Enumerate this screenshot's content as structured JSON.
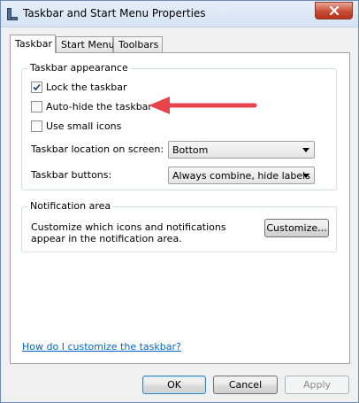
{
  "window": {
    "title": "Taskbar and Start Menu Properties",
    "close_glyph": "×"
  },
  "tabs": [
    {
      "label": "Taskbar",
      "active": true
    },
    {
      "label": "Start Menu",
      "active": false
    },
    {
      "label": "Toolbars",
      "active": false
    }
  ],
  "taskbar_appearance": {
    "label": "Taskbar appearance",
    "options": [
      {
        "label": "Lock the taskbar",
        "checked": true
      },
      {
        "label": "Auto-hide the taskbar",
        "checked": false
      },
      {
        "label": "Use small icons",
        "checked": false
      }
    ],
    "location": {
      "label": "Taskbar location on screen:",
      "value": "Bottom"
    },
    "buttons": {
      "label": "Taskbar buttons:",
      "value": "Always combine, hide labels"
    }
  },
  "notification_area": {
    "label": "Notification area",
    "description": "Customize which icons and notifications appear in the notification area.",
    "customize_label": "Customize..."
  },
  "help_link": "How do I customize the taskbar?",
  "footer": {
    "ok_label": "OK",
    "cancel_label": "Cancel",
    "apply_label": "Apply"
  },
  "colors": {
    "annotation_arrow": "#e8434a",
    "link": "#0066cc"
  }
}
